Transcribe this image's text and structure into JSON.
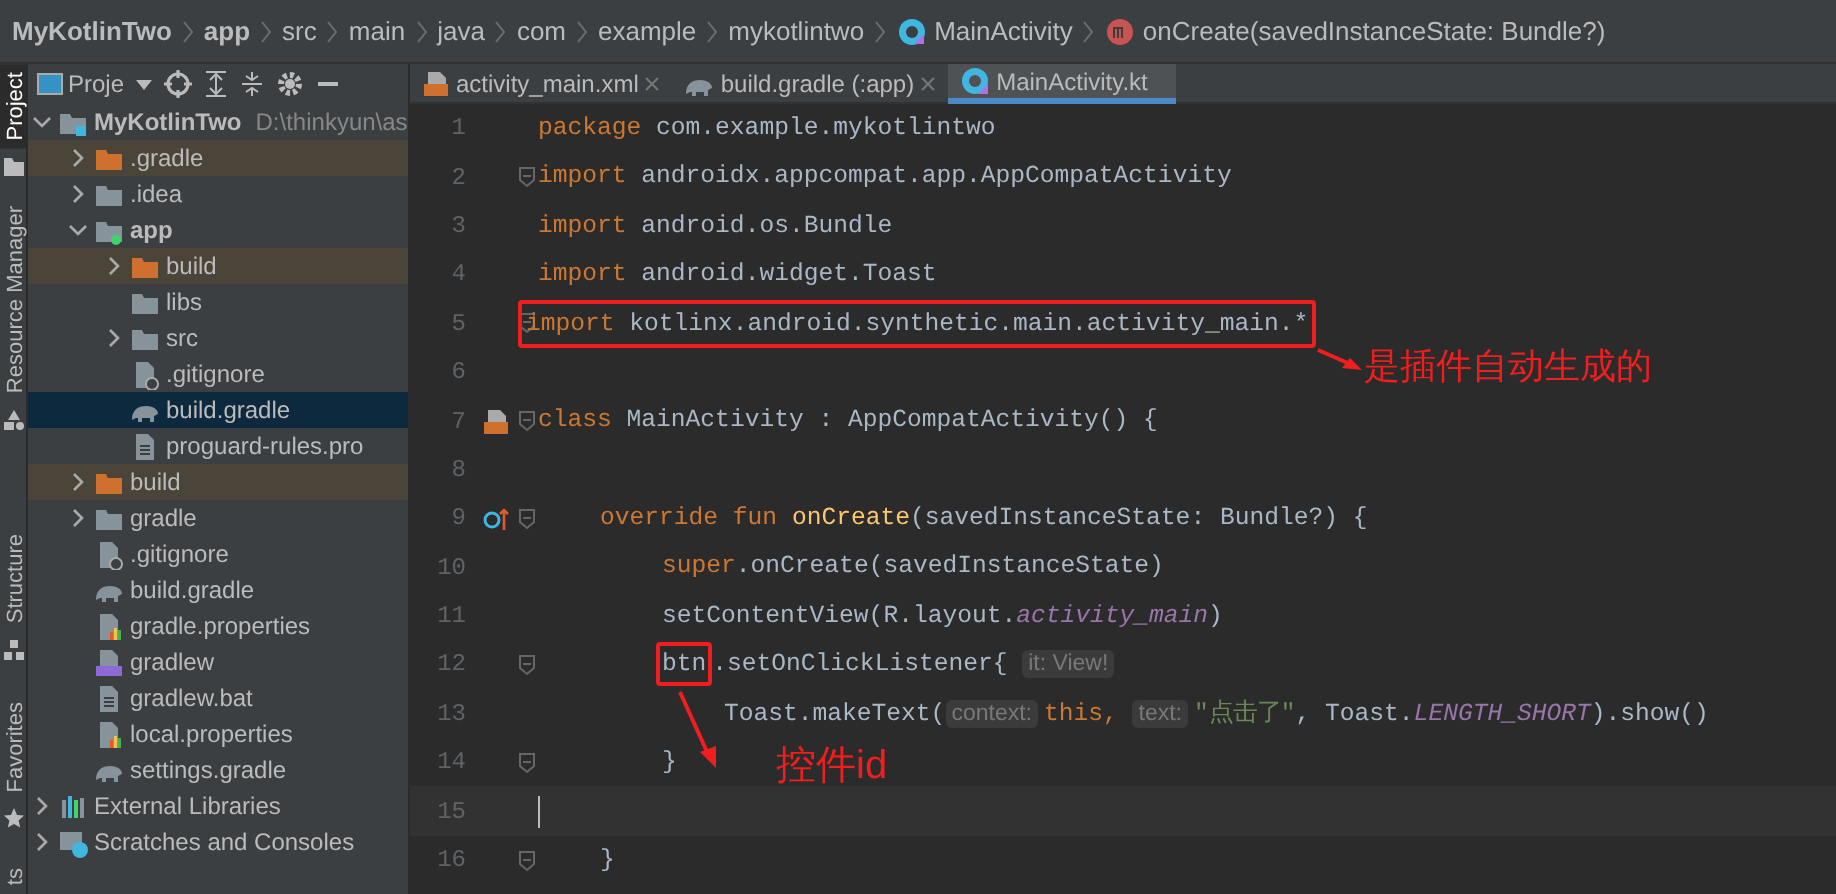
{
  "breadcrumb": [
    {
      "label": "MyKotlinTwo",
      "kind": "project"
    },
    {
      "label": "app",
      "kind": "module"
    },
    {
      "label": "src",
      "kind": "dir"
    },
    {
      "label": "main",
      "kind": "dir"
    },
    {
      "label": "java",
      "kind": "dir"
    },
    {
      "label": "com",
      "kind": "dir"
    },
    {
      "label": "example",
      "kind": "dir"
    },
    {
      "label": "mykotlintwo",
      "kind": "dir"
    },
    {
      "label": "MainActivity",
      "kind": "class"
    },
    {
      "label": "onCreate(savedInstanceState: Bundle?)",
      "kind": "method"
    }
  ],
  "side_strip": [
    {
      "label": "Project",
      "selected": true,
      "kind": "folder"
    },
    {
      "label": "Resource Manager",
      "selected": false,
      "kind": "res"
    },
    {
      "label": "Structure",
      "selected": false,
      "kind": "structure"
    },
    {
      "label": "Favorites",
      "selected": false,
      "kind": "star"
    },
    {
      "label": "ts",
      "selected": false,
      "kind": "none"
    }
  ],
  "project_panel": {
    "title": "Proje",
    "tree": [
      {
        "label": "MyKotlinTwo",
        "path": "D:\\thinkyun\\as",
        "kind": "project",
        "expanded": true,
        "selected": false,
        "excluded": false,
        "children": [
          {
            "label": ".gradle",
            "kind": "folder",
            "expanded": false,
            "selected": false,
            "excluded": true
          },
          {
            "label": ".idea",
            "kind": "folder",
            "expanded": false,
            "selected": false,
            "excluded": false
          },
          {
            "label": "app",
            "kind": "module",
            "expanded": true,
            "selected": false,
            "excluded": false,
            "children": [
              {
                "label": "build",
                "kind": "folder",
                "expanded": false,
                "selected": false,
                "excluded": true
              },
              {
                "label": "libs",
                "kind": "folder",
                "selected": false,
                "excluded": false
              },
              {
                "label": "src",
                "kind": "folder",
                "expanded": false,
                "selected": false,
                "excluded": false
              },
              {
                "label": ".gitignore",
                "kind": "ignore",
                "selected": false,
                "excluded": false
              },
              {
                "label": "build.gradle",
                "kind": "gradle",
                "selected": true,
                "excluded": false
              },
              {
                "label": "proguard-rules.pro",
                "kind": "text",
                "selected": false,
                "excluded": false
              }
            ]
          },
          {
            "label": "build",
            "kind": "folder",
            "expanded": false,
            "selected": false,
            "excluded": true
          },
          {
            "label": "gradle",
            "kind": "folder",
            "expanded": false,
            "selected": false,
            "excluded": false
          },
          {
            "label": ".gitignore",
            "kind": "ignore",
            "selected": false,
            "excluded": false
          },
          {
            "label": "build.gradle",
            "kind": "gradle",
            "selected": false,
            "excluded": false
          },
          {
            "label": "gradle.properties",
            "kind": "props",
            "selected": false,
            "excluded": false
          },
          {
            "label": "gradlew",
            "kind": "script",
            "selected": false,
            "excluded": false
          },
          {
            "label": "gradlew.bat",
            "kind": "text",
            "selected": false,
            "excluded": false
          },
          {
            "label": "local.properties",
            "kind": "props",
            "selected": false,
            "excluded": false
          },
          {
            "label": "settings.gradle",
            "kind": "gradle",
            "selected": false,
            "excluded": false
          }
        ]
      },
      {
        "label": "External Libraries",
        "kind": "libs",
        "expanded": false,
        "selected": false,
        "excluded": false
      },
      {
        "label": "Scratches and Consoles",
        "kind": "scratch",
        "expanded": false,
        "selected": false,
        "excluded": false
      }
    ]
  },
  "editor_tabs": [
    {
      "label": "activity_main.xml",
      "kind": "xml",
      "selected": false
    },
    {
      "label": "build.gradle (:app)",
      "kind": "gradle",
      "selected": false
    },
    {
      "label": "MainActivity.kt",
      "kind": "class",
      "selected": true
    }
  ],
  "code": [
    {
      "number": "1",
      "tokens": [
        {
          "text": "package",
          "kind": "kw"
        },
        {
          "text": " com.example.mykotlintwo",
          "kind": "plain"
        }
      ]
    },
    {
      "number": "2",
      "fold": true,
      "tokens": [
        {
          "text": "import",
          "kind": "kw"
        },
        {
          "text": " androidx.appcompat.app.AppCompatActivity",
          "kind": "plain"
        }
      ]
    },
    {
      "number": "3",
      "tokens": [
        {
          "text": "import",
          "kind": "kw"
        },
        {
          "text": " android.os.Bundle",
          "kind": "plain"
        }
      ]
    },
    {
      "number": "4",
      "tokens": [
        {
          "text": "import",
          "kind": "kw"
        },
        {
          "text": " android.widget.Toast",
          "kind": "plain"
        }
      ]
    },
    {
      "number": "5",
      "fold": true,
      "boxed": true,
      "tokens": [
        {
          "text": "import",
          "kind": "kw"
        },
        {
          "text": " kotlinx.android.synthetic.main.activity_main.*",
          "kind": "plain"
        }
      ]
    },
    {
      "number": "6"
    },
    {
      "number": "7",
      "kind": "layout",
      "fold": true,
      "tokens": [
        {
          "text": "class",
          "kind": "kw"
        },
        {
          "text": " MainActivity : AppCompatActivity() {",
          "kind": "plain"
        }
      ],
      "children": [
        {
          "number": "8"
        },
        {
          "number": "9",
          "kind": "override",
          "fold": true,
          "tokens": [
            {
              "text": "override fun ",
              "kind": "kw"
            },
            {
              "text": "onCreate",
              "kind": "fn"
            },
            {
              "text": "(savedInstanceState: Bundle?) {",
              "kind": "plain"
            }
          ],
          "children": [
            {
              "number": "10",
              "tokens": [
                {
                  "text": "super",
                  "kind": "kw"
                },
                {
                  "text": ".onCreate(savedInstanceState)",
                  "kind": "plain"
                }
              ]
            },
            {
              "number": "11",
              "tokens": [
                {
                  "text": "setContentView(R.layout.",
                  "kind": "plain"
                },
                {
                  "text": "activity_main",
                  "kind": "field"
                },
                {
                  "text": ")",
                  "kind": "plain"
                }
              ]
            },
            {
              "number": "12",
              "fold": true,
              "tokens": [
                {
                  "text": "btn",
                  "kind": "plain",
                  "boxed": true
                },
                {
                  "text": ".setOnClickListener{ ",
                  "kind": "plain"
                },
                {
                  "text": "it: View!",
                  "kind": "hint"
                }
              ],
              "children": [
                {
                  "number": "13",
                  "tokens": [
                    {
                      "text": "Toast.makeText(",
                      "kind": "plain"
                    },
                    {
                      "text": "context:",
                      "kind": "hint"
                    },
                    {
                      "text": "this, ",
                      "kind": "kw"
                    },
                    {
                      "text": "text:",
                      "kind": "hint"
                    },
                    {
                      "text": "\"点击了\"",
                      "kind": "str"
                    },
                    {
                      "text": ", Toast.",
                      "kind": "plain"
                    },
                    {
                      "text": "LENGTH_SHORT",
                      "kind": "field"
                    },
                    {
                      "text": ").show()",
                      "kind": "plain"
                    }
                  ]
                }
              ]
            },
            {
              "number": "14",
              "fold": true,
              "tokens": [
                {
                  "text": "}",
                  "kind": "plain"
                }
              ]
            }
          ]
        },
        {
          "number": "15",
          "current": true
        },
        {
          "number": "16",
          "fold": true,
          "tokens": [
            {
              "text": "}",
              "kind": "plain"
            }
          ]
        }
      ]
    }
  ],
  "annotations": [
    {
      "text": "是插件自动生成的"
    },
    {
      "text": "控件id"
    }
  ]
}
